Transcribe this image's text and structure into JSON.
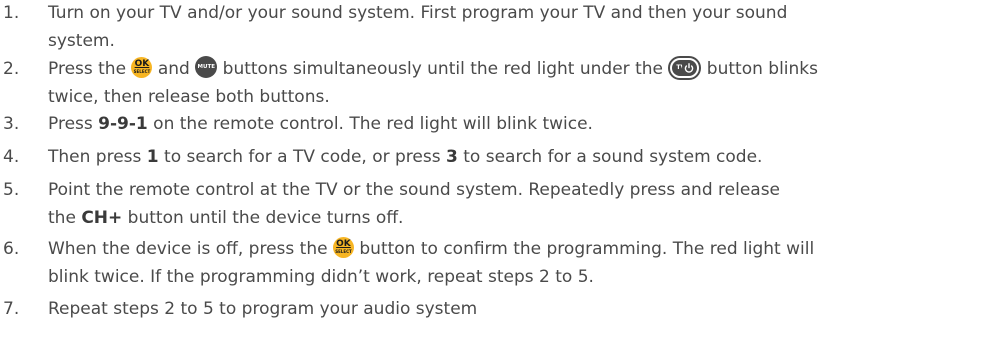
{
  "steps": [
    {
      "number": "1.",
      "parts": {
        "a": "Turn on your TV and/or your sound system. First program your TV and then your sound",
        "b": "system."
      }
    },
    {
      "number": "2.",
      "parts": {
        "a": "Press the",
        "b": "and",
        "c": "buttons simultaneously until the red light under the",
        "d": "button blinks",
        "e": "twice, then release both buttons."
      }
    },
    {
      "number": "3.",
      "parts": {
        "a": "Press",
        "b": "9-9-1",
        "c": "on the remote control. The red light will blink twice."
      }
    },
    {
      "number": "4.",
      "parts": {
        "a": "Then press",
        "b": "1",
        "c": "to search for a TV code, or press",
        "d": "3",
        "e": "to search for a sound system code."
      }
    },
    {
      "number": "5.",
      "parts": {
        "a": "Point the remote control at the TV or the sound system. Repeatedly press and release",
        "b": "the",
        "c": "CH+",
        "d": "button until the device turns off."
      }
    },
    {
      "number": "6.",
      "parts": {
        "a": "When the device is off, press the",
        "b": "button to confirm the programming. The red light will",
        "c": "blink twice. If the programming didn’t work, repeat steps 2 to 5."
      }
    },
    {
      "number": "7.",
      "parts": {
        "a": "Repeat steps 2 to 5 to program your audio system"
      }
    }
  ],
  "icons": {
    "ok_select": {
      "top": "OK",
      "bottom": "SELECT",
      "color": "#f7b523"
    },
    "mute": {
      "label": "MUTE",
      "color": "#4a4a4a"
    },
    "tv_power": {
      "label": "TV"
    }
  }
}
